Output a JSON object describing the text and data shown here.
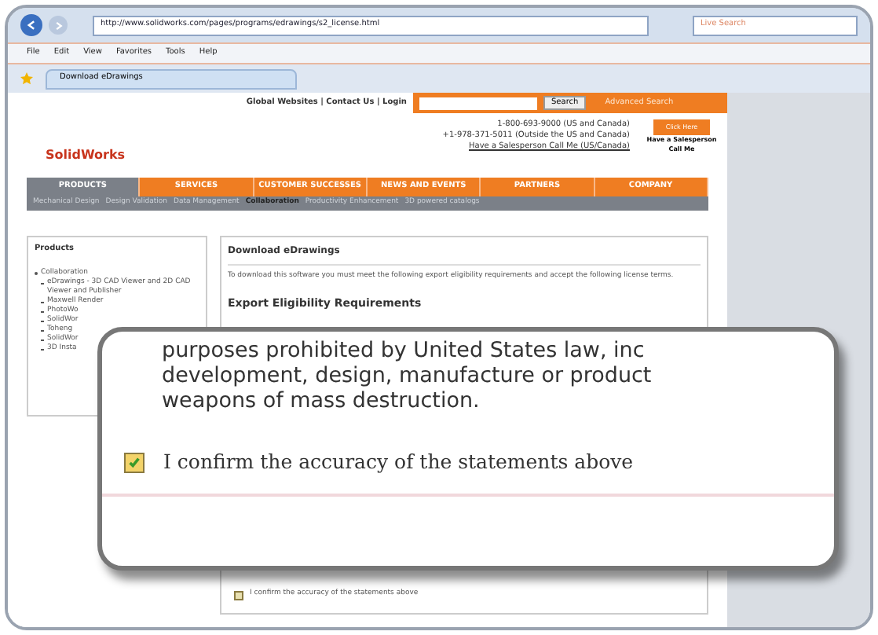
{
  "browser": {
    "address": "http://www.solidworks.com/pages/programs/edrawings/s2_license.html",
    "search_placeholder": "Live Search",
    "menu": [
      "File",
      "Edit",
      "View",
      "Favorites",
      "Tools",
      "Help"
    ],
    "tab": "Download eDrawings"
  },
  "header": {
    "links": "Global Websites | Contact Us | Login",
    "search_button": "Search",
    "advanced": "Advanced Search",
    "logo": "SolidWorks",
    "phones": [
      "1-800-693-9000 (US and Canada)",
      "+1-978-371-5011 (Outside the US and Canada)"
    ],
    "call_link": "Have a Salesperson Call Me (US/Canada)",
    "click_here": "Click Here",
    "click_caption": "Have a Salesperson Call Me"
  },
  "nav": [
    {
      "label": "PRODUCTS",
      "selected": true
    },
    {
      "label": "SERVICES",
      "selected": false
    },
    {
      "label": "CUSTOMER SUCCESSES",
      "selected": false
    },
    {
      "label": "NEWS AND EVENTS",
      "selected": false
    },
    {
      "label": "PARTNERS",
      "selected": false
    },
    {
      "label": "COMPANY",
      "selected": false
    }
  ],
  "subnav": [
    {
      "label": "Mechanical Design",
      "selected": false
    },
    {
      "label": "Design Validation",
      "selected": false
    },
    {
      "label": "Data Management",
      "selected": false
    },
    {
      "label": "Collaboration",
      "selected": true
    },
    {
      "label": "Productivity Enhancement",
      "selected": false
    },
    {
      "label": "3D powered catalogs",
      "selected": false
    }
  ],
  "sidebar": {
    "title": "Products",
    "items": [
      {
        "label": "Collaboration",
        "children": [
          {
            "label": "eDrawings - 3D CAD Viewer and 2D CAD Viewer and Publisher"
          },
          {
            "label": "Maxwell Render"
          },
          {
            "label": "PhotoWo"
          },
          {
            "label": "SolidWor"
          },
          {
            "label": "Toheng"
          },
          {
            "label": "SolidWor"
          },
          {
            "label": "3D Insta"
          }
        ]
      }
    ]
  },
  "main": {
    "title": "Download eDrawings",
    "intro": "To download this software you must meet the following export eligibility requirements and accept the following license terms.",
    "section": "Export Eligibility Requirements",
    "confirm": {
      "label": "I confirm the accuracy of the statements above",
      "checked": false
    }
  },
  "callout": {
    "lines": [
      "purposes prohibited by United States law, inc",
      "development, design, manufacture or product",
      "weapons of mass destruction."
    ],
    "confirm": {
      "label": "I confirm the accuracy of the statements above",
      "checked": true
    }
  }
}
